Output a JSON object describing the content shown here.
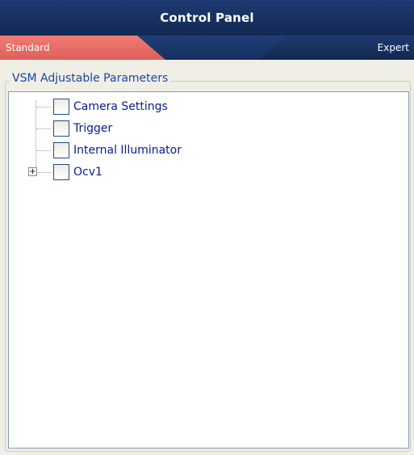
{
  "window": {
    "title": "Control Panel"
  },
  "tabs": [
    {
      "label": "Standard",
      "active": true,
      "color": "#e8675f"
    },
    {
      "label": "Expert",
      "active": false
    }
  ],
  "group": {
    "title": "VSM Adjustable Parameters"
  },
  "tree": {
    "nodes": [
      {
        "label": "Camera Settings",
        "checked": false,
        "expandable": false
      },
      {
        "label": "Trigger",
        "checked": false,
        "expandable": false
      },
      {
        "label": "Internal Illuminator",
        "checked": false,
        "expandable": false
      },
      {
        "label": "Ocv1",
        "checked": false,
        "expandable": true,
        "expanded": false,
        "expander_symbol": "+"
      }
    ]
  },
  "colors": {
    "title_bar": "#1a3569",
    "tab_active": "#e8675f",
    "label_text": "#0a1a8f",
    "group_title": "#1a45a6"
  }
}
